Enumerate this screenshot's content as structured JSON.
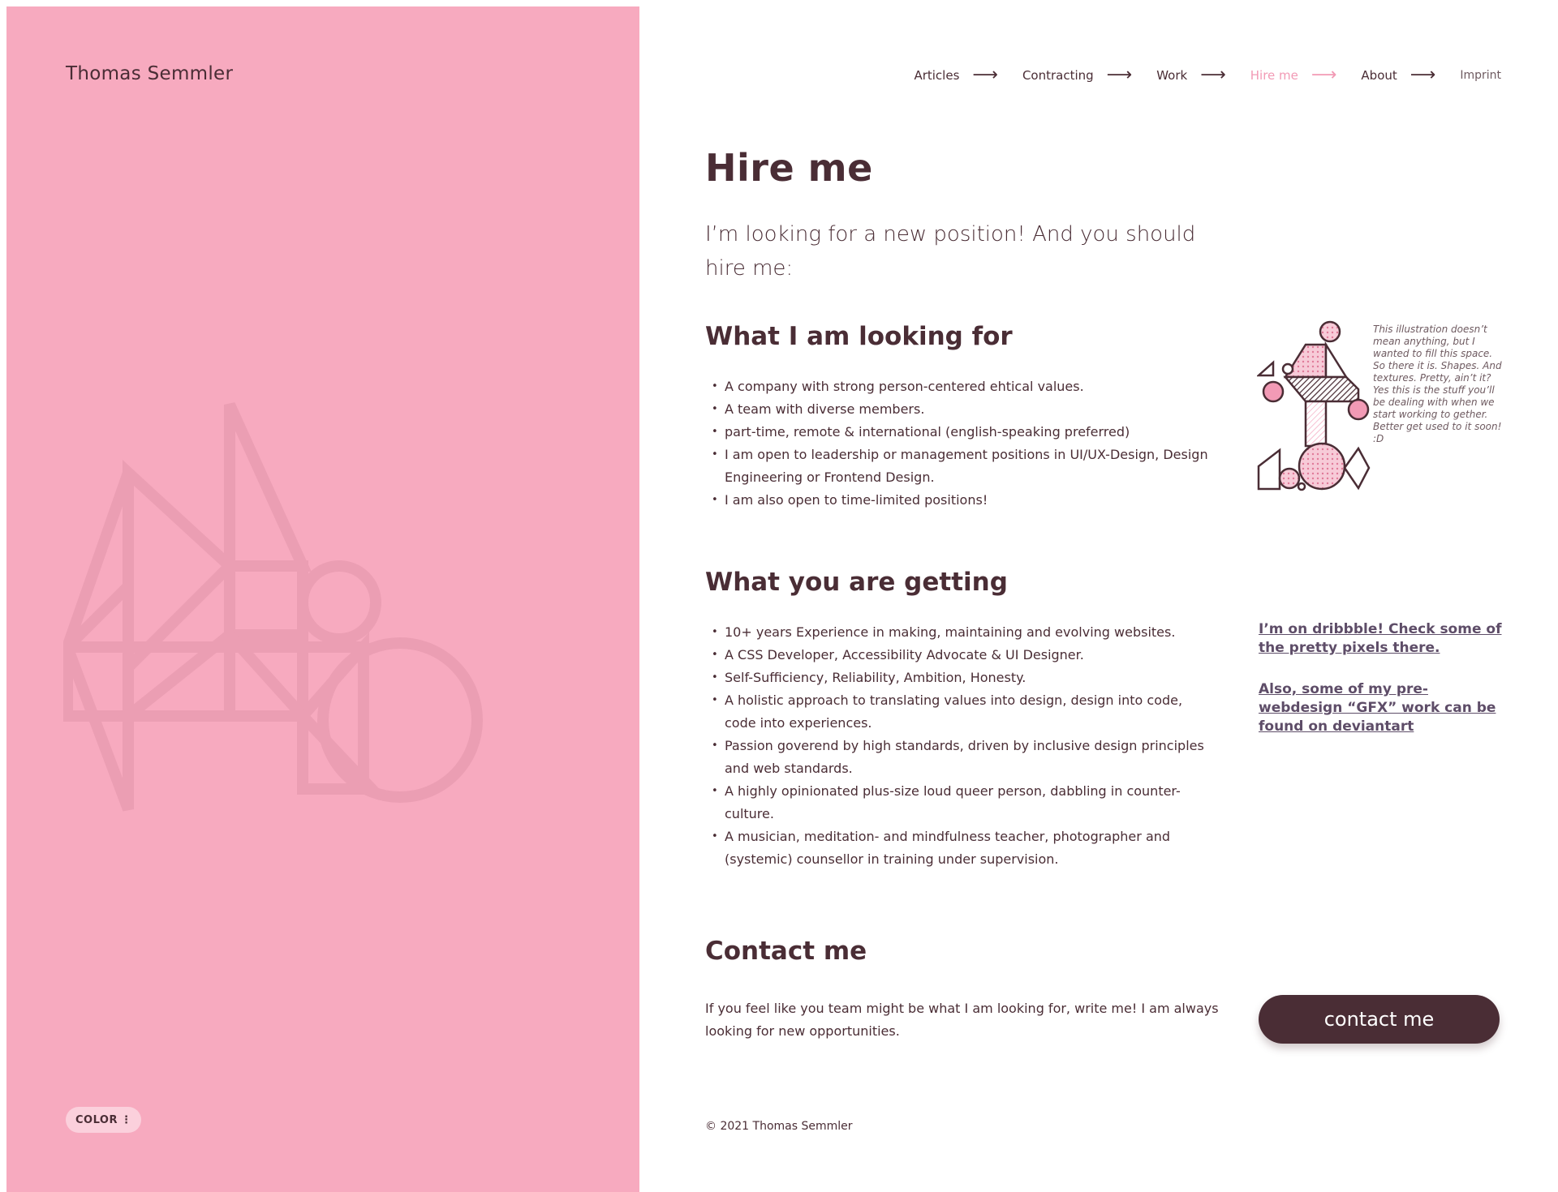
{
  "brand": {
    "name": "Thomas Semmler"
  },
  "color_button": {
    "label": "COLOR",
    "icon": "more-vertical-icon"
  },
  "nav": {
    "items": [
      {
        "label": "Articles",
        "arrow": "⟶"
      },
      {
        "label": "Contracting",
        "arrow": "⟶"
      },
      {
        "label": "Work",
        "arrow": "⟶"
      },
      {
        "label": "Hire me",
        "arrow": "⟶"
      },
      {
        "label": "About",
        "arrow": "⟶"
      }
    ],
    "imprint": "Imprint"
  },
  "page": {
    "title": "Hire me",
    "intro": "I’m looking for a new position! And you should hire me:"
  },
  "looking_for": {
    "title": "What I am looking for",
    "items": [
      "A company with strong person-centered ehtical values.",
      "A team with diverse members.",
      "part-time, remote & international (english-speaking preferred)",
      "I am open to leadership or management positions in UI/UX-Design, Design Engineering or Frontend Design.",
      "I am also open to time-limited positions!"
    ],
    "illustration_note": "This illustration doesn’t mean anything, but I wanted to fill this space. So there it is. Shapes. And textures. Pretty, ain’t it? Yes this is the stuff you’ll be dealing with when we start working to gether. Better get used to it soon! :D"
  },
  "getting": {
    "title": "What you are getting",
    "items": [
      "10+ years Experience in making, maintaining and evolving websites.",
      "A CSS Developer, Accessibility Advocate & UI Designer.",
      "Self-Sufficiency, Reliability, Ambition, Honesty.",
      "A holistic approach to translating values into design, design into code, code into experiences.",
      "Passion goverend by high standards, driven by inclusive design principles and web standards.",
      "A highly opinionated plus-size loud queer person, dabbling in counter-culture.",
      "A musician, meditation- and mindfulness teacher, photographer and (systemic) counsellor in training under supervision."
    ],
    "links": [
      "I’m on dribbble! Check some of the pretty pixels there.",
      "Also, some of my pre-webdesign “GFX” work can be found on deviantart"
    ]
  },
  "contact": {
    "title": "Contact me",
    "text": "If you feel like you team might be what I am looking for, write me! I am always looking for new opportunities.",
    "button": "contact me"
  },
  "footer": {
    "copyright": "© 2021 Thomas Semmler"
  },
  "colors": {
    "pink": "#f7aabf",
    "dark": "#4a2d35",
    "active_nav": "#f29ab5",
    "link": "#5e4d68"
  }
}
